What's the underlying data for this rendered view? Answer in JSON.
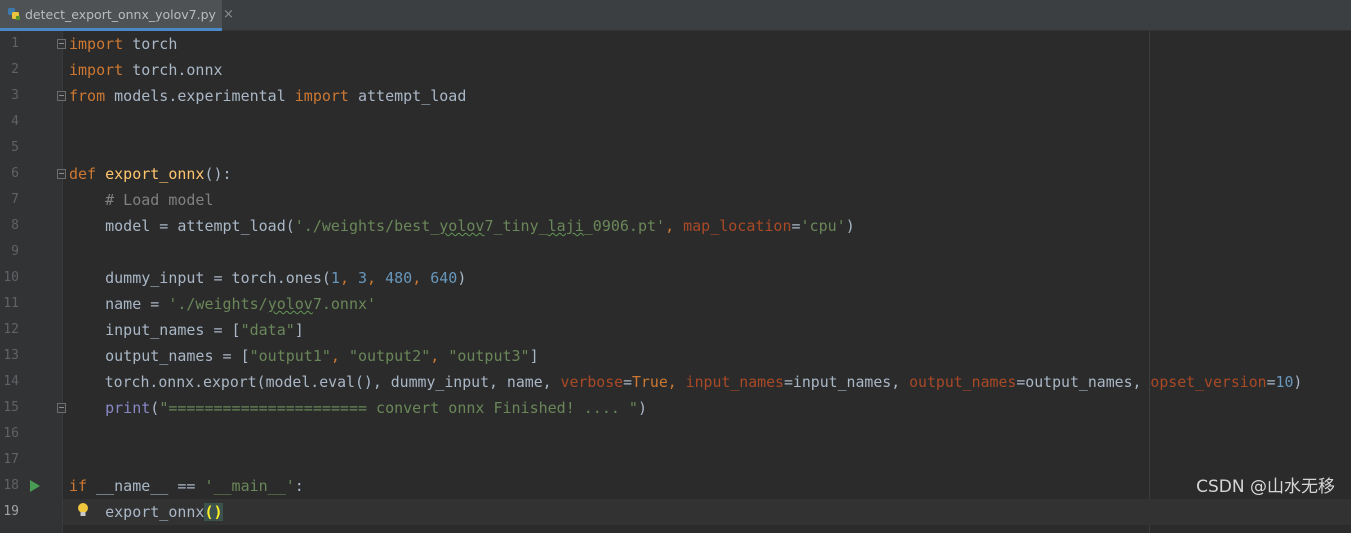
{
  "tab": {
    "filename": "detect_export_onnx_yolov7.py",
    "close_glyph": "×"
  },
  "lines": [
    {
      "n": "1"
    },
    {
      "n": "2"
    },
    {
      "n": "3"
    },
    {
      "n": "4"
    },
    {
      "n": "5"
    },
    {
      "n": "6"
    },
    {
      "n": "7"
    },
    {
      "n": "8"
    },
    {
      "n": "9"
    },
    {
      "n": "10"
    },
    {
      "n": "11"
    },
    {
      "n": "12"
    },
    {
      "n": "13"
    },
    {
      "n": "14"
    },
    {
      "n": "15"
    },
    {
      "n": "16"
    },
    {
      "n": "17"
    },
    {
      "n": "18"
    },
    {
      "n": "19"
    }
  ],
  "code": {
    "l1": {
      "kw": "import",
      "rest": " torch"
    },
    "l2": {
      "kw": "import",
      "rest": " torch.onnx"
    },
    "l3": {
      "kw1": "from",
      "mid": " models.experimental ",
      "kw2": "import",
      "rest": " attempt_load"
    },
    "l6": {
      "kw": "def",
      "sp": " ",
      "fn": "export_onnx",
      "rest": "():"
    },
    "l7": {
      "comment": "    # Load model"
    },
    "l8": {
      "pre": "    model = attempt_load(",
      "s1": "'./weights/best_",
      "s1w": "yolov",
      "s1b": "7_tiny_",
      "s1c": "laji",
      "s1d": "_0906.pt'",
      "comma": ", ",
      "param": "map_location",
      "eq": "=",
      "s2": "'cpu'",
      "end": ")"
    },
    "l10": {
      "pre": "    dummy_input = torch.ones(",
      "n1": "1",
      "c1": ", ",
      "n2": "3",
      "c2": ", ",
      "n3": "480",
      "c3": ", ",
      "n4": "640",
      "end": ")"
    },
    "l11": {
      "pre": "    name = ",
      "s1": "'./weights/",
      "s1w": "yolov",
      "s1b": "7.onnx'"
    },
    "l12": {
      "pre": "    input_names = [",
      "s1": "\"data\"",
      "end": "]"
    },
    "l13": {
      "pre": "    output_names = [",
      "s1": "\"output1\"",
      "c1": ", ",
      "s2": "\"output2\"",
      "c2": ", ",
      "s3": "\"output3\"",
      "end": "]"
    },
    "l14": {
      "pre": "    torch.onnx.export(model.eval(), dummy_input, name, ",
      "p1": "verbose",
      "e1": "=",
      "v1": "True",
      "c1": ", ",
      "p2": "input_names",
      "e2": "=input_names, ",
      "p3": "output_names",
      "e3": "=output_names, ",
      "p4": "opset_version",
      "e4": "=",
      "v4": "10",
      "end": ")"
    },
    "l15": {
      "pre": "    ",
      "fn": "print",
      "open": "(",
      "s1": "\"====================== convert onnx Finished! .... \"",
      "end": ")"
    },
    "l18": {
      "kw": "if",
      "mid": " __name__ == ",
      "s1": "'__main__'",
      "end": ":"
    },
    "l19": {
      "pre": "    export_onnx",
      "paren": "()"
    }
  },
  "watermark": "CSDN @山水无移",
  "icons": [
    "python-file-icon",
    "close-icon",
    "fold-icon",
    "run-icon",
    "lightbulb-icon"
  ],
  "colors": {
    "background": "#2b2b2b",
    "keyword": "#cc7832",
    "function": "#ffc66d",
    "string": "#6a8759",
    "number": "#6897bb",
    "comment": "#808080",
    "param": "#aa4926"
  }
}
